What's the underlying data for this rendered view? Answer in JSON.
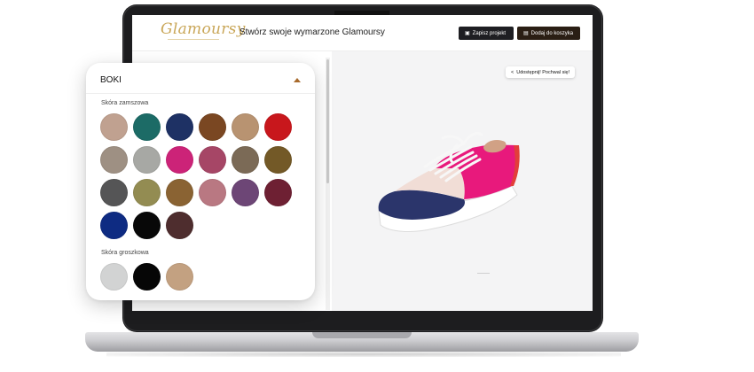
{
  "header": {
    "logo": "Glamoursy",
    "title": "Stwórz swoje wymarzone Glamoursy",
    "save_button": "Zapisz projekt",
    "cart_button": "Dodaj do koszyka"
  },
  "canvas": {
    "share_button": "Udostępnij! Pochwal się!"
  },
  "panel": {
    "title": "BOKI",
    "sections": [
      {
        "label": "Skóra zamszowa",
        "colors": [
          "#c0a190",
          "#1c6b66",
          "#1e3164",
          "#7a4722",
          "#b89371",
          "#c8171c",
          "#9e9083",
          "#a7a8a4",
          "#cc2378",
          "#a64666",
          "#7b6a56",
          "#735927",
          "#555556",
          "#938c52",
          "#8a6333",
          "#b97882",
          "#6d4676",
          "#6e2033",
          "#0e2b82",
          "#080808",
          "#4e2d2e"
        ]
      },
      {
        "label": "Skóra groszkowa",
        "colors": [
          "#d2d3d3",
          "#060606",
          "#c3a181"
        ]
      }
    ]
  },
  "shoe_colors": {
    "side": "#e8197c",
    "toe": "#2b356b",
    "vamp": "#f1ddd6",
    "sole": "#ffffff",
    "heel_accent": "#e23e3a",
    "collar": "#d1a185",
    "laces": "#f7f7f7"
  }
}
